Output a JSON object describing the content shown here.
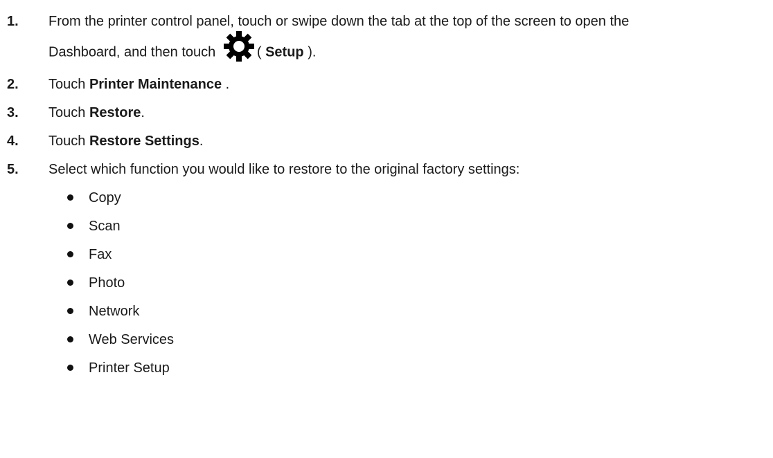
{
  "steps": [
    {
      "number": "1.",
      "line1": "From the printer control panel, touch or swipe down the tab at the top of the screen to open the",
      "line2_before": "Dashboard, and then touch",
      "line2_paren_open": "(",
      "line2_bold": "Setup",
      "line2_after": ").",
      "icon": "gear-icon"
    },
    {
      "number": "2.",
      "before": "Touch",
      "bold": "Printer Maintenance",
      "after": " ."
    },
    {
      "number": "3.",
      "before": "Touch",
      "bold": "Restore",
      "after": "."
    },
    {
      "number": "4.",
      "before": "Touch",
      "bold": "Restore Settings",
      "after": "."
    },
    {
      "number": "5.",
      "text": "Select which function you would like to restore to the original factory settings:"
    }
  ],
  "options": [
    "Copy",
    "Scan",
    "Fax",
    "Photo",
    "Network",
    "Web Services",
    "Printer Setup"
  ]
}
